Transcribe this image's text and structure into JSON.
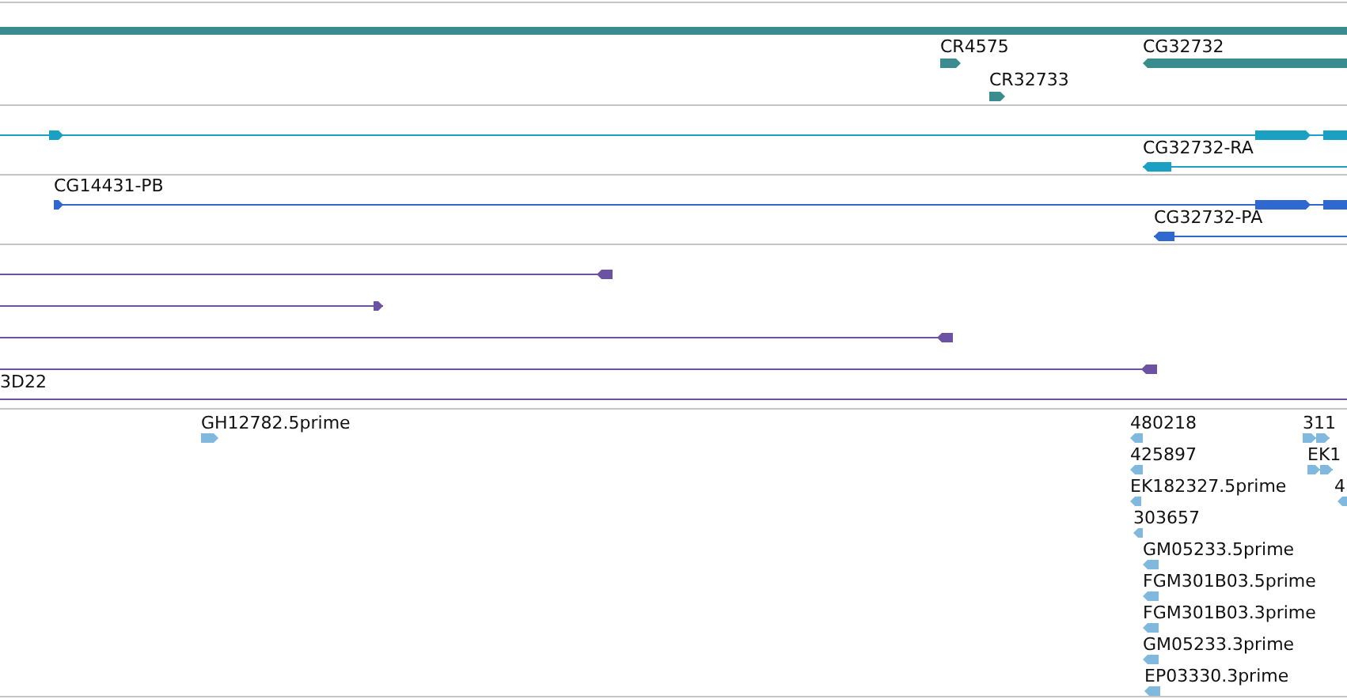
{
  "tracks": [
    {
      "kind": "gene",
      "color": "#3a8c8f",
      "features": [
        {
          "label": "CR4575",
          "reverse": false
        },
        {
          "label": "CR32733",
          "reverse": false
        },
        {
          "label": "CG32732",
          "reverse": true
        }
      ]
    },
    {
      "kind": "transcript",
      "color": "#1aa0c2",
      "features": [
        {
          "label": "CG32732-RA",
          "reverse": true
        }
      ]
    },
    {
      "kind": "transcript",
      "color": "#2f68cf",
      "features": [
        {
          "label": "CG14431-PB",
          "reverse": false
        },
        {
          "label": "CG32732-PA",
          "reverse": true
        }
      ]
    },
    {
      "kind": "alignment",
      "color": "#6b52a3",
      "features": [
        {
          "label": "3D22"
        }
      ]
    },
    {
      "kind": "est",
      "color": "#80b9dd",
      "features": [
        {
          "label": "GH12782.5prime",
          "reverse": false
        },
        {
          "label": "480218",
          "reverse": true
        },
        {
          "label": "425897",
          "reverse": true
        },
        {
          "label": "EK182327.5prime",
          "reverse": true
        },
        {
          "label": "303657",
          "reverse": true
        },
        {
          "label": "GM05233.5prime",
          "reverse": true
        },
        {
          "label": "FGM301B03.5prime",
          "reverse": true
        },
        {
          "label": "FGM301B03.3prime",
          "reverse": true
        },
        {
          "label": "GM05233.3prime",
          "reverse": true
        },
        {
          "label": "EP03330.3prime",
          "reverse": true
        },
        {
          "label": "311",
          "reverse": false
        },
        {
          "label": "EK1",
          "reverse": false
        },
        {
          "label": "4",
          "reverse": true
        }
      ]
    }
  ]
}
